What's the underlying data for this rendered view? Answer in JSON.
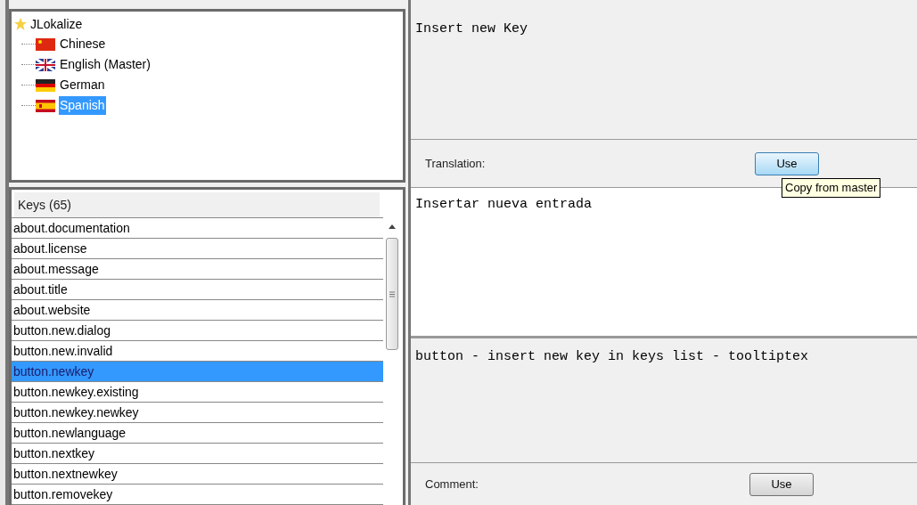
{
  "tree": {
    "root": "JLokalize",
    "children": [
      {
        "label": "Chinese",
        "selected": false
      },
      {
        "label": "English (Master)",
        "selected": false
      },
      {
        "label": "German",
        "selected": false
      },
      {
        "label": "Spanish",
        "selected": true
      }
    ]
  },
  "keys": {
    "header": "Keys (65)",
    "items": [
      {
        "label": "about.documentation",
        "selected": false
      },
      {
        "label": "about.license",
        "selected": false
      },
      {
        "label": "about.message",
        "selected": false
      },
      {
        "label": "about.title",
        "selected": false
      },
      {
        "label": "about.website",
        "selected": false
      },
      {
        "label": "button.new.dialog",
        "selected": false
      },
      {
        "label": "button.new.invalid",
        "selected": false
      },
      {
        "label": "button.newkey",
        "selected": true
      },
      {
        "label": "button.newkey.existing",
        "selected": false
      },
      {
        "label": "button.newkey.newkey",
        "selected": false
      },
      {
        "label": "button.newlanguage",
        "selected": false
      },
      {
        "label": "button.nextkey",
        "selected": false
      },
      {
        "label": "button.nextnewkey",
        "selected": false
      },
      {
        "label": "button.removekey",
        "selected": false
      }
    ]
  },
  "master_text": "Insert new Key",
  "translation": {
    "label": "Translation:",
    "button": "Use",
    "hovered": true,
    "tooltip": "Copy from master",
    "text": "Insertar nueva entrada"
  },
  "comment": {
    "text": "button - insert new key in keys list - tooltiptex",
    "label": "Comment:",
    "button": "Use",
    "hovered": false
  }
}
